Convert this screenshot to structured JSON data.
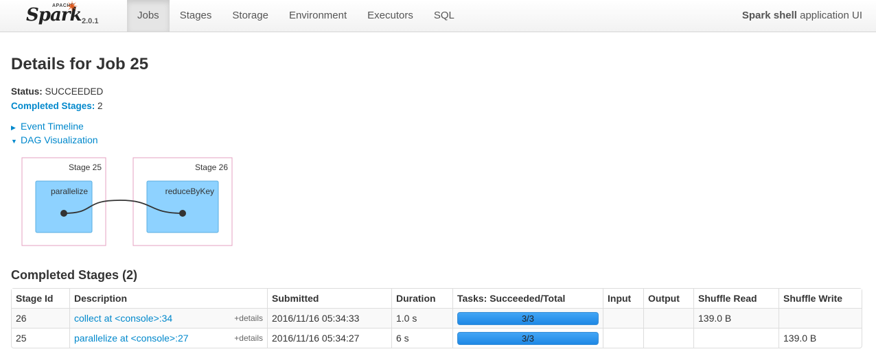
{
  "navbar": {
    "brand": {
      "apache": "APACHE",
      "name": "Spark",
      "version": "2.0.1"
    },
    "tabs": [
      {
        "label": "Jobs",
        "active": true
      },
      {
        "label": "Stages",
        "active": false
      },
      {
        "label": "Storage",
        "active": false
      },
      {
        "label": "Environment",
        "active": false
      },
      {
        "label": "Executors",
        "active": false
      },
      {
        "label": "SQL",
        "active": false
      }
    ],
    "app_name": "Spark shell",
    "app_suffix": " application UI"
  },
  "page": {
    "title": "Details for Job 25",
    "status_label": "Status:",
    "status_value": " SUCCEEDED",
    "completed_stages_label": "Completed Stages:",
    "completed_stages_value": " 2",
    "event_timeline": "Event Timeline",
    "dag_visualization": "DAG Visualization"
  },
  "dag": {
    "stages": [
      {
        "label": "Stage 25",
        "op": "parallelize"
      },
      {
        "label": "Stage 26",
        "op": "reduceByKey"
      }
    ],
    "colors": {
      "cluster_border": "#e6a0c0",
      "op_fill": "#8ed2ff",
      "op_border": "#5aaee0"
    }
  },
  "completed": {
    "title": "Completed Stages (2)",
    "headers": [
      "Stage Id",
      "Description",
      "Submitted",
      "Duration",
      "Tasks: Succeeded/Total",
      "Input",
      "Output",
      "Shuffle Read",
      "Shuffle Write"
    ],
    "details_label": "+details",
    "rows": [
      {
        "id": "26",
        "description": "collect at <console>:34",
        "submitted": "2016/11/16 05:34:33",
        "duration": "1.0 s",
        "tasks": "3/3",
        "input": "",
        "output": "",
        "shuffle_read": "139.0 B",
        "shuffle_write": ""
      },
      {
        "id": "25",
        "description": "parallelize at <console>:27",
        "submitted": "2016/11/16 05:34:27",
        "duration": "6 s",
        "tasks": "3/3",
        "input": "",
        "output": "",
        "shuffle_read": "",
        "shuffle_write": "139.0 B"
      }
    ]
  }
}
